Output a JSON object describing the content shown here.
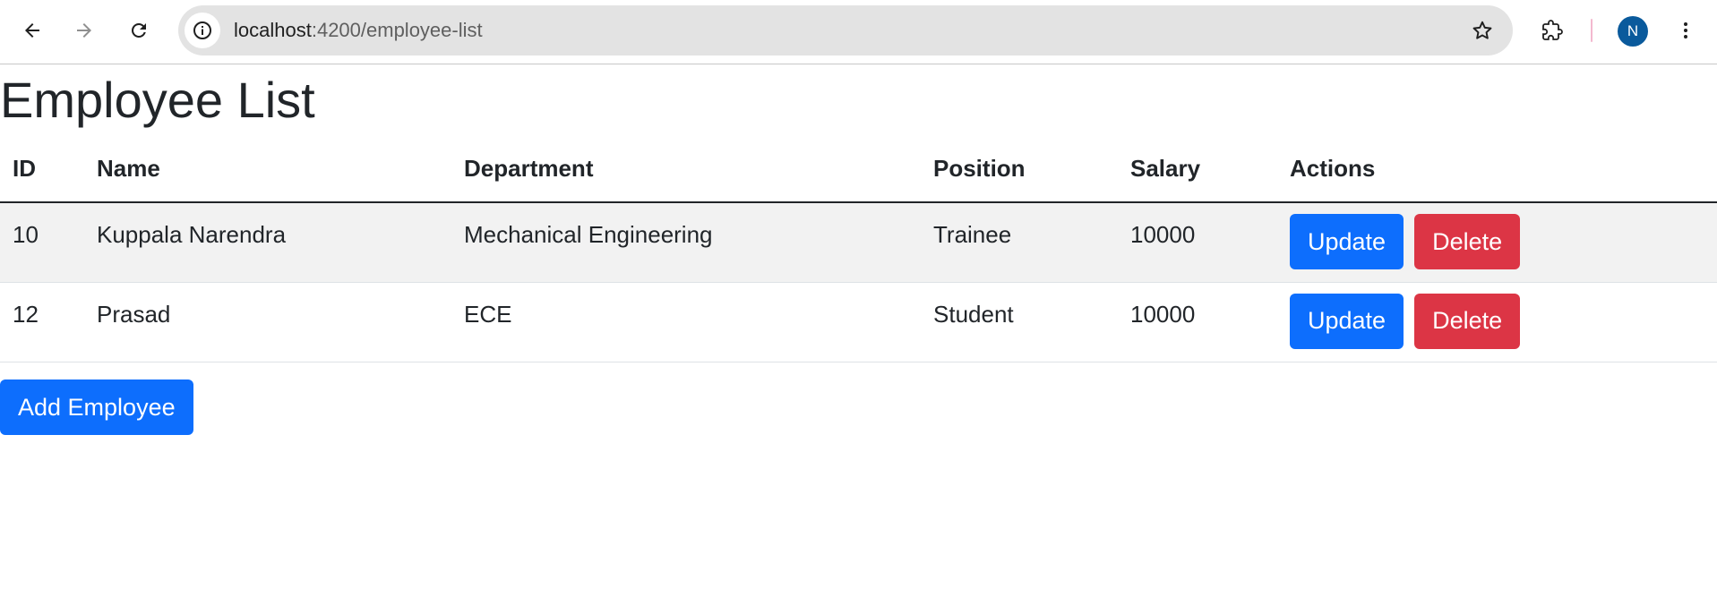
{
  "browser": {
    "url_host": "localhost",
    "url_path": ":4200/employee-list",
    "profile_initial": "N"
  },
  "page": {
    "title": "Employee List"
  },
  "table": {
    "headers": [
      "ID",
      "Name",
      "Department",
      "Position",
      "Salary",
      "Actions"
    ],
    "rows": [
      {
        "id": "10",
        "name": "Kuppala Narendra",
        "department": "Mechanical Engineering",
        "position": "Trainee",
        "salary": "10000",
        "update_label": "Update",
        "delete_label": "Delete"
      },
      {
        "id": "12",
        "name": "Prasad",
        "department": "ECE",
        "position": "Student",
        "salary": "10000",
        "update_label": "Update",
        "delete_label": "Delete"
      }
    ]
  },
  "add_button_label": "Add Employee",
  "colors": {
    "primary": "#0d6efd",
    "danger": "#dc3545",
    "striped_row": "#f2f2f2",
    "avatar": "#0a5a9c"
  },
  "icons": [
    "back-arrow-icon",
    "forward-arrow-icon",
    "reload-icon",
    "site-info-icon",
    "bookmark-star-icon",
    "extensions-icon",
    "more-menu-icon"
  ]
}
